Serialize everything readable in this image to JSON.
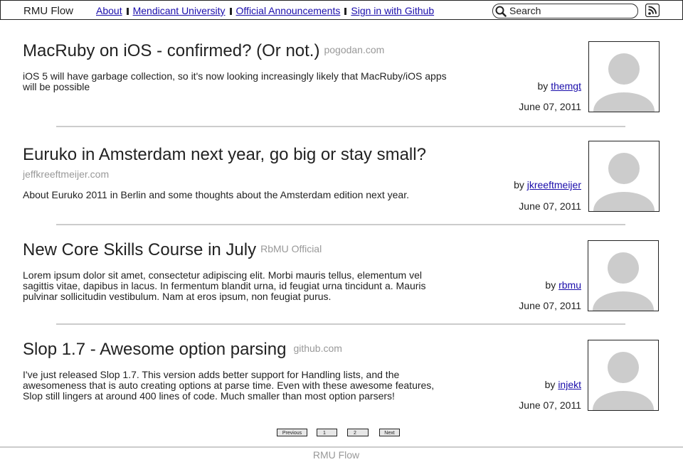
{
  "header": {
    "brand": "RMU Flow",
    "nav": [
      {
        "label": "About"
      },
      {
        "label": "Mendicant University"
      },
      {
        "label": "Official Announcements"
      },
      {
        "label": "Sign in with Github"
      }
    ],
    "search": {
      "placeholder": "Search",
      "value": ""
    }
  },
  "posts": [
    {
      "title": "MacRuby on iOS - confirmed? (Or not.)",
      "source": "pogodan.com",
      "excerpt": "iOS 5 will have garbage collection, so it's now looking increasingly likely that MacRuby/iOS apps will be possible",
      "by": "by",
      "author": " themgt",
      "date": "June 07, 2011"
    },
    {
      "title": "Euruko in Amsterdam next year, go big or stay small?",
      "source": "jeffkreeftmeijer.com",
      "excerpt": "About Euruko 2011 in Berlin and some thoughts about the Amsterdam edition next year.",
      "by": "by",
      "author": "jkreeftmeijer",
      "date": "June 07, 2011"
    },
    {
      "title": "New Core Skills Course in July",
      "source": "RbMU Official",
      "excerpt": "Lorem ipsum dolor sit amet, consectetur adipiscing elit. Morbi mauris tellus, elementum vel sagittis vitae, dapibus in lacus. In fermentum blandit urna, id feugiat urna tincidunt a. Mauris pulvinar sollicitudin vestibulum. Nam at eros ipsum, non feugiat purus.",
      "by": "by",
      "author": "rbmu",
      "date": "June 07, 2011"
    },
    {
      "title": "Slop 1.7 - Awesome option parsing",
      "source": "github.com",
      "excerpt": "I've just released Slop 1.7. This version adds better support for Handling lists, and the awesomeness that is auto creating options at parse time. Even with these awesome features, Slop still lingers at around 400 lines of code. Much smaller than most option parsers!",
      "by": "by",
      "author": "injekt",
      "date": "June 07, 2011"
    }
  ],
  "pagination": {
    "previous": "Previous",
    "page1": "1",
    "page2": "2",
    "next": "Next"
  },
  "footer": {
    "text": "RMU Flow"
  }
}
